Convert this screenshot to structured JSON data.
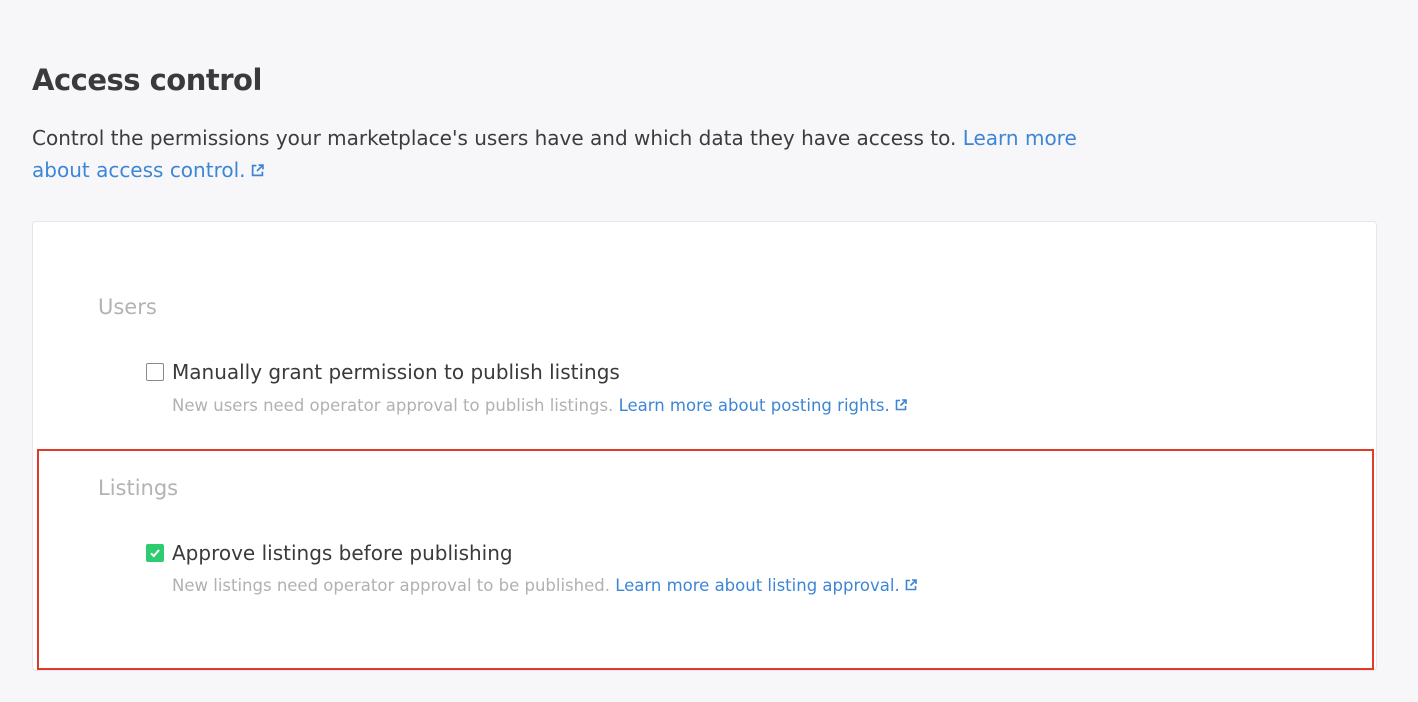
{
  "header": {
    "title": "Access control",
    "description": "Control the permissions your marketplace's users have and which data they have access to.",
    "learn_more_label": "Learn more about access control."
  },
  "sections": {
    "users": {
      "label": "Users",
      "option_label": "Manually grant permission to publish listings",
      "checked": false,
      "help_text": "New users need operator approval to publish listings.",
      "help_link": "Learn more about posting rights."
    },
    "listings": {
      "label": "Listings",
      "option_label": "Approve listings before publishing",
      "checked": true,
      "help_text": "New listings need operator approval to be published.",
      "help_link": "Learn more about listing approval."
    }
  },
  "icons": {
    "external_link": "external-link-icon",
    "checkmark": "checkmark-icon"
  },
  "colors": {
    "link": "#3d86d6",
    "checkbox_checked": "#2ecc71",
    "highlight_border": "#e03a2a",
    "section_label": "#b3b3b3"
  }
}
